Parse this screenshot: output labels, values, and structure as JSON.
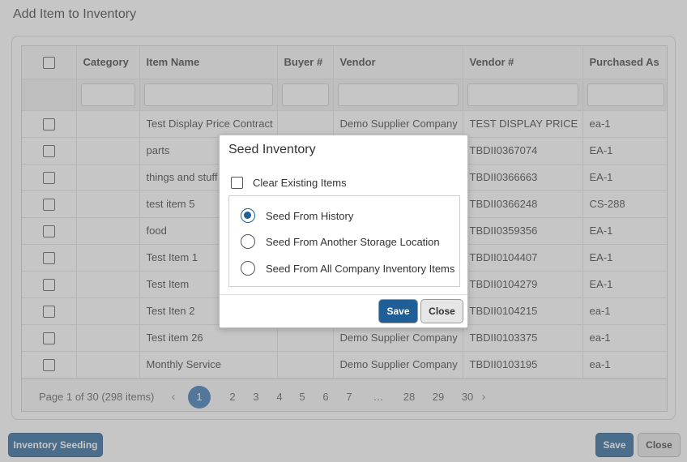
{
  "dialog": {
    "title": "Add Item to Inventory",
    "columns": [
      "Category",
      "Item Name",
      "Buyer #",
      "Vendor",
      "Vendor #",
      "Purchased As"
    ],
    "rows": [
      {
        "category": "",
        "item_name": "Test Display Price Contract",
        "buyer": "",
        "vendor": "Demo Supplier Company",
        "vendor_no": "TEST DISPLAY PRICE",
        "purchased_as": "ea-1"
      },
      {
        "category": "",
        "item_name": "parts",
        "buyer": "",
        "vendor": "",
        "vendor_no": "TBDII0367074",
        "purchased_as": "EA-1"
      },
      {
        "category": "",
        "item_name": "things and stuff",
        "buyer": "",
        "vendor": "",
        "vendor_no": "TBDII0366663",
        "purchased_as": "EA-1"
      },
      {
        "category": "",
        "item_name": "test item 5",
        "buyer": "",
        "vendor": "",
        "vendor_no": "TBDII0366248",
        "purchased_as": "CS-288"
      },
      {
        "category": "",
        "item_name": "food",
        "buyer": "",
        "vendor": "",
        "vendor_no": "TBDII0359356",
        "purchased_as": "EA-1"
      },
      {
        "category": "",
        "item_name": "Test Item 1",
        "buyer": "",
        "vendor": "",
        "vendor_no": "TBDII0104407",
        "purchased_as": "EA-1"
      },
      {
        "category": "",
        "item_name": "Test Item",
        "buyer": "",
        "vendor": "",
        "vendor_no": "TBDII0104279",
        "purchased_as": "EA-1"
      },
      {
        "category": "",
        "item_name": "Test Iten 2",
        "buyer": "",
        "vendor": "",
        "vendor_no": "TBDII0104215",
        "purchased_as": "ea-1"
      },
      {
        "category": "",
        "item_name": "Test item 26",
        "buyer": "",
        "vendor": "Demo Supplier Company",
        "vendor_no": "TBDII0103375",
        "purchased_as": "ea-1"
      },
      {
        "category": "",
        "item_name": "Monthly Service",
        "buyer": "",
        "vendor": "Demo Supplier Company",
        "vendor_no": "TBDII0103195",
        "purchased_as": "ea-1"
      }
    ],
    "pager": {
      "info": "Page 1 of 30 (298 items)",
      "prev_icon": "chevron-left-icon",
      "next_icon": "chevron-right-icon",
      "prev": "‹",
      "next": "›",
      "pages": [
        "1",
        "2",
        "3",
        "4",
        "5",
        "6",
        "7",
        "…",
        "28",
        "29",
        "30"
      ],
      "current": "1"
    },
    "footer": {
      "inventory_seeding": "Inventory Seeding",
      "save": "Save",
      "close": "Close"
    }
  },
  "modal": {
    "title": "Seed Inventory",
    "clear_existing_label": "Clear Existing Items",
    "clear_existing_checked": false,
    "options": [
      {
        "label": "Seed From History",
        "checked": true
      },
      {
        "label": "Seed From Another Storage Location",
        "checked": false
      },
      {
        "label": "Seed From All Company Inventory Items",
        "checked": false
      }
    ],
    "save": "Save",
    "close": "Close"
  },
  "colors": {
    "primary": "#1f5e96",
    "pager_active": "#2f6fb0",
    "overlay": "rgba(128,128,128,0.45)"
  }
}
